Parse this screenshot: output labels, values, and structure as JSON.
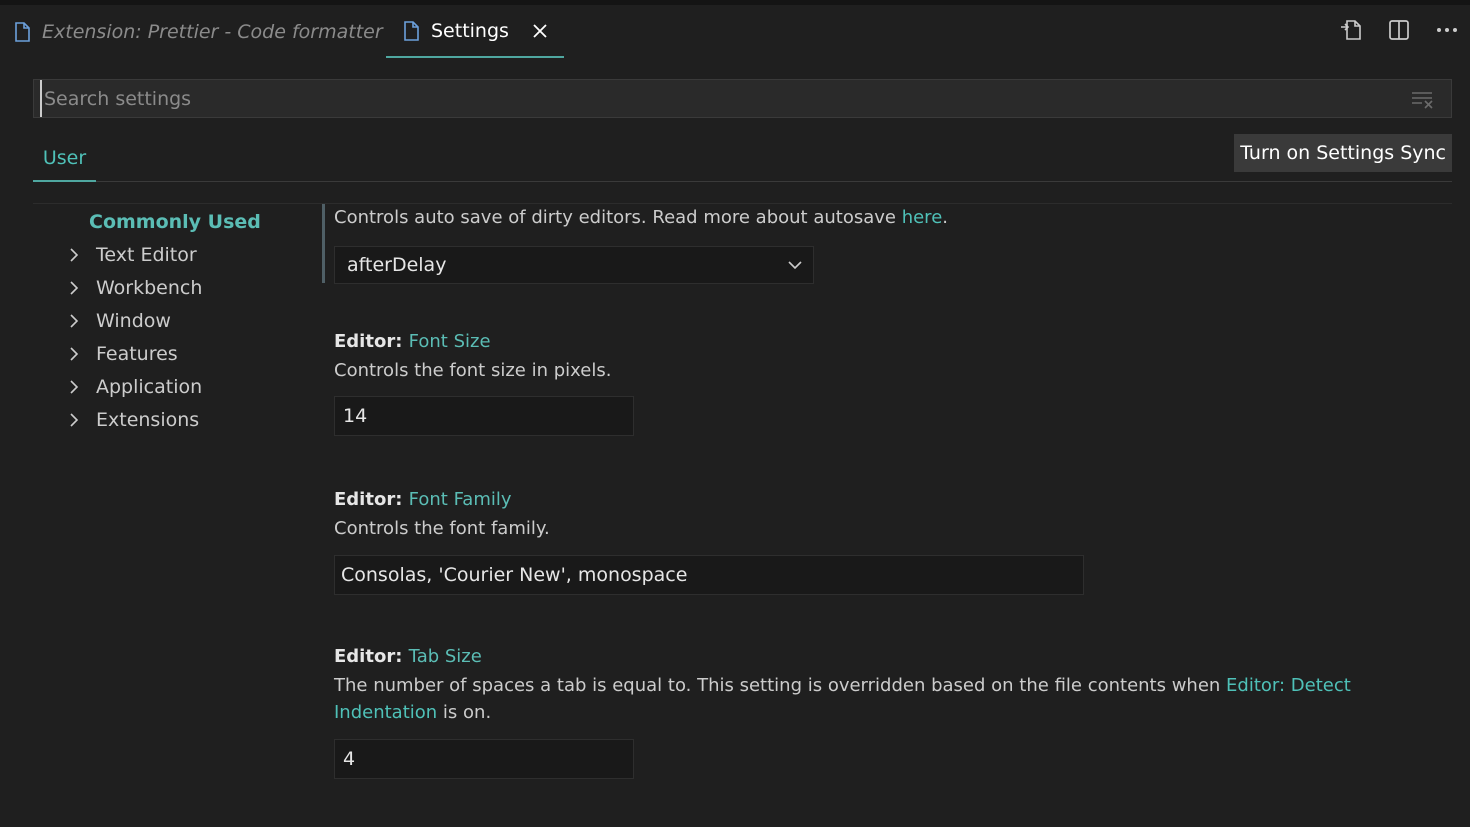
{
  "tabs": [
    {
      "label": "Extension: Prettier - Code formatter",
      "active": false,
      "italic": true
    },
    {
      "label": "Settings",
      "active": true
    }
  ],
  "actions": [
    "open-settings-json-icon",
    "split-editor-icon",
    "more-actions-icon"
  ],
  "search": {
    "placeholder": "Search settings",
    "value": ""
  },
  "scope": {
    "user_label": "User",
    "sync_label": "Turn on Settings Sync"
  },
  "toc": {
    "active": "Commonly Used",
    "items": [
      "Text Editor",
      "Workbench",
      "Window",
      "Features",
      "Application",
      "Extensions"
    ]
  },
  "settings": {
    "auto_save": {
      "description": "Controls auto save of dirty editors. Read more about autosave ",
      "link": "here",
      "suffix": ".",
      "value": "afterDelay"
    },
    "font_size": {
      "category": "Editor: ",
      "name": "Font Size",
      "description": "Controls the font size in pixels.",
      "value": "14"
    },
    "font_family": {
      "category": "Editor: ",
      "name": "Font Family",
      "description": "Controls the font family.",
      "value": "Consolas, 'Courier New', monospace"
    },
    "tab_size": {
      "category": "Editor: ",
      "name": "Tab Size",
      "description": "The number of spaces a tab is equal to. This setting is overridden based on the file contents when ",
      "link": "Editor: Detect Indentation",
      "suffix": " is on.",
      "value": "4"
    }
  },
  "colors": {
    "accent": "#4fc1b8",
    "background": "#1f1f1f",
    "input_bg": "#191919"
  }
}
